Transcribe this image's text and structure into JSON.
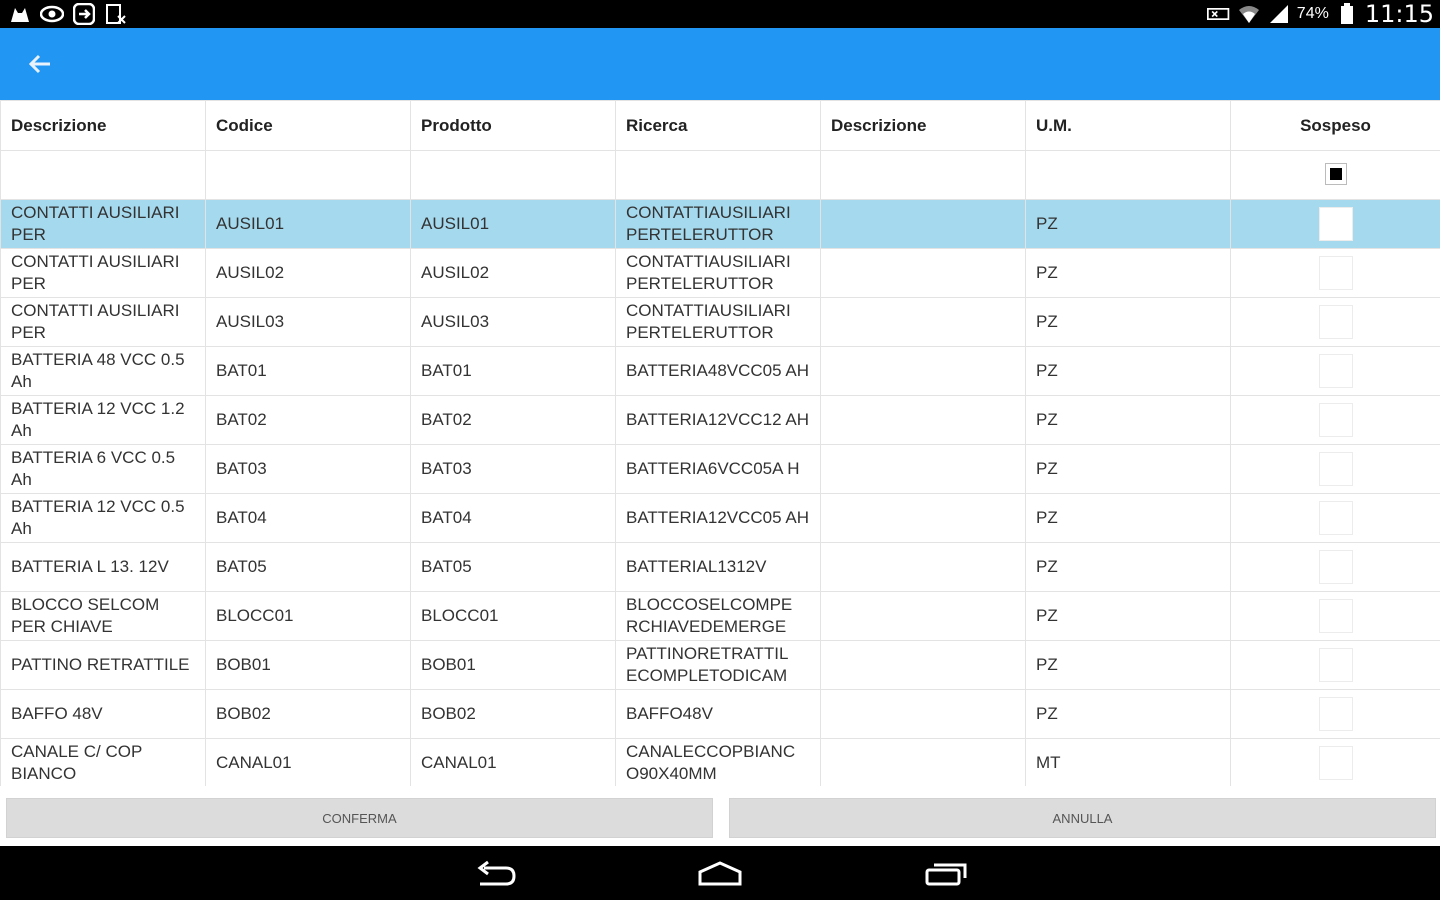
{
  "status_bar": {
    "left_icons": [
      "cat-icon",
      "eye-icon",
      "circle-arrow-icon",
      "document-x-icon"
    ],
    "right_icons": [
      "mute-icon",
      "wifi-icon",
      "signal-icon",
      "battery-icon"
    ],
    "battery": "74%",
    "time": "11:15"
  },
  "app_bar": {
    "color": "#2196f3",
    "back_icon": "arrow-left-icon"
  },
  "table": {
    "headers": [
      "Descrizione",
      "Codice",
      "Prodotto",
      "Ricerca",
      "Descrizione",
      "U.M.",
      "Sospeso"
    ],
    "filter_checkbox": "indeterminate",
    "selected_row": 0,
    "rows": [
      {
        "descrizione": "CONTATTI AUSILIARI PER",
        "codice": "AUSIL01",
        "prodotto": "AUSIL01",
        "ricerca": "CONTATTIAUSILIARI PERTELERUTTOR",
        "descrizione2": "",
        "um": "PZ"
      },
      {
        "descrizione": "CONTATTI AUSILIARI PER",
        "codice": "AUSIL02",
        "prodotto": "AUSIL02",
        "ricerca": "CONTATTIAUSILIARI PERTELERUTTOR",
        "descrizione2": "",
        "um": "PZ"
      },
      {
        "descrizione": "CONTATTI AUSILIARI PER",
        "codice": "AUSIL03",
        "prodotto": "AUSIL03",
        "ricerca": "CONTATTIAUSILIARI PERTELERUTTOR",
        "descrizione2": "",
        "um": "PZ"
      },
      {
        "descrizione": "BATTERIA 48 VCC 0.5 Ah",
        "codice": "BAT01",
        "prodotto": "BAT01",
        "ricerca": "BATTERIA48VCC05 AH",
        "descrizione2": "",
        "um": "PZ"
      },
      {
        "descrizione": "BATTERIA 12 VCC 1.2 Ah",
        "codice": "BAT02",
        "prodotto": "BAT02",
        "ricerca": "BATTERIA12VCC12 AH",
        "descrizione2": "",
        "um": "PZ"
      },
      {
        "descrizione": "BATTERIA 6 VCC 0.5 Ah",
        "codice": "BAT03",
        "prodotto": "BAT03",
        "ricerca": "BATTERIA6VCC05A H",
        "descrizione2": "",
        "um": "PZ"
      },
      {
        "descrizione": "BATTERIA 12 VCC 0.5 Ah",
        "codice": "BAT04",
        "prodotto": "BAT04",
        "ricerca": "BATTERIA12VCC05 AH",
        "descrizione2": "",
        "um": "PZ"
      },
      {
        "descrizione": "BATTERIA L 13. 12V",
        "codice": "BAT05",
        "prodotto": "BAT05",
        "ricerca": "BATTERIAL1312V",
        "descrizione2": "",
        "um": "PZ"
      },
      {
        "descrizione": "BLOCCO SELCOM PER CHIAVE",
        "codice": "BLOCC01",
        "prodotto": "BLOCC01",
        "ricerca": "BLOCCOSELCOMPE RCHIAVEDEMERGE",
        "descrizione2": "",
        "um": "PZ"
      },
      {
        "descrizione": "PATTINO RETRATTILE",
        "codice": "BOB01",
        "prodotto": "BOB01",
        "ricerca": "PATTINORETRATTIL ECOMPLETODICAM",
        "descrizione2": "",
        "um": "PZ"
      },
      {
        "descrizione": "BAFFO 48V",
        "codice": "BOB02",
        "prodotto": "BOB02",
        "ricerca": "BAFFO48V",
        "descrizione2": "",
        "um": "PZ"
      },
      {
        "descrizione": "CANALE C/ COP BIANCO",
        "codice": "CANAL01",
        "prodotto": "CANAL01",
        "ricerca": "CANALECCOPBIANC O90X40MM",
        "descrizione2": "",
        "um": "MT"
      }
    ]
  },
  "buttons": {
    "confirm": "CONFERMA",
    "cancel": "ANNULLA"
  },
  "nav_bar": {
    "icons": [
      "back-icon",
      "home-icon",
      "recents-icon"
    ]
  }
}
